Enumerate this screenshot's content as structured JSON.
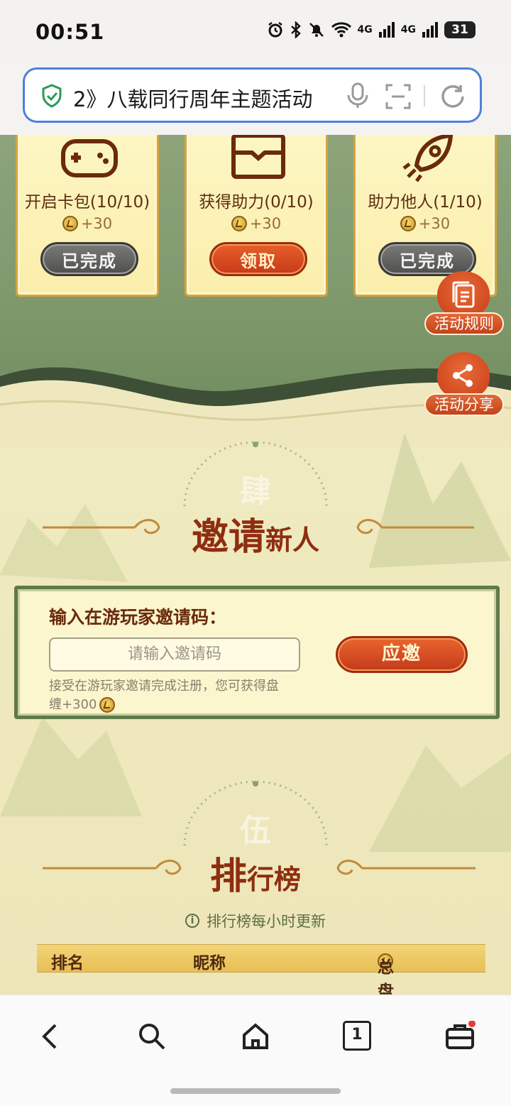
{
  "status_bar": {
    "time": "00:51",
    "network": "4G",
    "battery": "31"
  },
  "url_bar": {
    "title": "2》八载同行周年主题活动"
  },
  "tasks": [
    {
      "label": "开启卡包(10/10)",
      "reward": "+30",
      "button": "已完成",
      "icon": "gamepad-icon",
      "state": "done"
    },
    {
      "label": "获得助力(0/10)",
      "reward": "+30",
      "button": "领取",
      "icon": "wallet-icon",
      "state": "claim"
    },
    {
      "label": "助力他人(1/10)",
      "reward": "+30",
      "button": "已完成",
      "icon": "rocket-icon",
      "state": "done"
    }
  ],
  "side_buttons": {
    "rules": "活动规则",
    "share": "活动分享"
  },
  "invite_section": {
    "bg_char": "肆",
    "title_big": "邀请",
    "title_small": "新人",
    "heading": "输入在游玩家邀请码：",
    "input_placeholder": "请输入邀请码",
    "accept_button": "应邀",
    "note_line1": "接受在游玩家邀请完成注册，您可获得盘",
    "note_line2": "缠+300"
  },
  "rank_section": {
    "bg_char": "伍",
    "title_big": "排",
    "title_small": "行榜",
    "update_note": "排行榜每小时更新",
    "columns": [
      "排名",
      "昵称",
      "总盘缠"
    ]
  },
  "colors": {
    "accent_red": "#c83e1a",
    "brand_green": "#7d976b",
    "cream": "#efe8bf",
    "url_border": "#4e80dd"
  },
  "bottom_nav": {
    "tab_count": "1",
    "icons": [
      "back-icon",
      "search-icon",
      "home-icon",
      "tabs-icon",
      "briefcase-icon"
    ]
  }
}
